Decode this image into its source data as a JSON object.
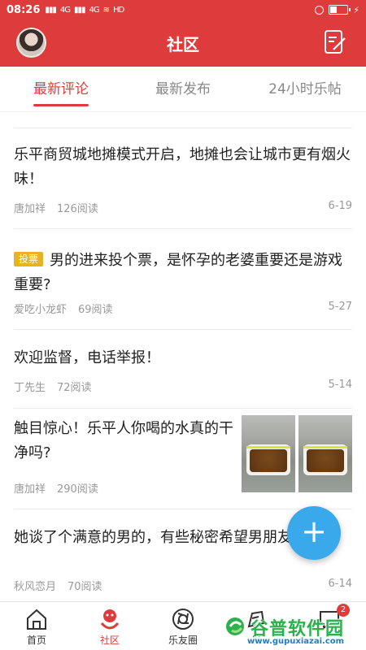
{
  "status_bar": {
    "time": "08:26",
    "signal1": "4G",
    "signal2": "4G",
    "hd": "HD"
  },
  "header": {
    "title": "社区"
  },
  "tabs": [
    {
      "label": "最新评论",
      "active": true
    },
    {
      "label": "最新发布",
      "active": false
    },
    {
      "label": "24小时乐帖",
      "active": false
    }
  ],
  "posts": [
    {
      "title": "乐平商贸城地摊模式开启，地摊也会让城市更有烟火味！",
      "author": "唐加祥",
      "reads": "126阅读",
      "date": "6-19"
    },
    {
      "badge": "投票",
      "title": "男的进来投个票，是怀孕的老婆重要还是游戏重要?",
      "author": "爱吃小龙虾",
      "reads": "69阅读",
      "date": "5-27"
    },
    {
      "title": "欢迎监督，电话举报！",
      "author": "丁先生",
      "reads": "72阅读",
      "date": "5-14"
    },
    {
      "title": "触目惊心！乐平人你喝的水真的干净吗?",
      "author": "唐加祥",
      "reads": "290阅读",
      "date": ""
    },
    {
      "title": "她谈了个满意的男的，有些秘密希望男朋友不知道",
      "author": "秋风恋月",
      "reads": "70阅读",
      "date": "6-14"
    }
  ],
  "fab": {
    "label": "+"
  },
  "bottom_nav": [
    {
      "label": "首页",
      "icon": "home-icon",
      "active": false
    },
    {
      "label": "社区",
      "icon": "community-icon",
      "active": true
    },
    {
      "label": "乐友圈",
      "icon": "moments-icon",
      "active": false
    },
    {
      "label": "发",
      "icon": "post-icon",
      "active": false
    },
    {
      "label": "",
      "icon": "message-icon",
      "active": false,
      "badge": "2"
    }
  ],
  "watermark": {
    "text": "谷普软件园",
    "url": "www.gupuxiazai.com"
  },
  "colors": {
    "brand_red": "#de3c3c",
    "fab_blue": "#3aa9ec",
    "vote_badge": "#e8b323"
  }
}
